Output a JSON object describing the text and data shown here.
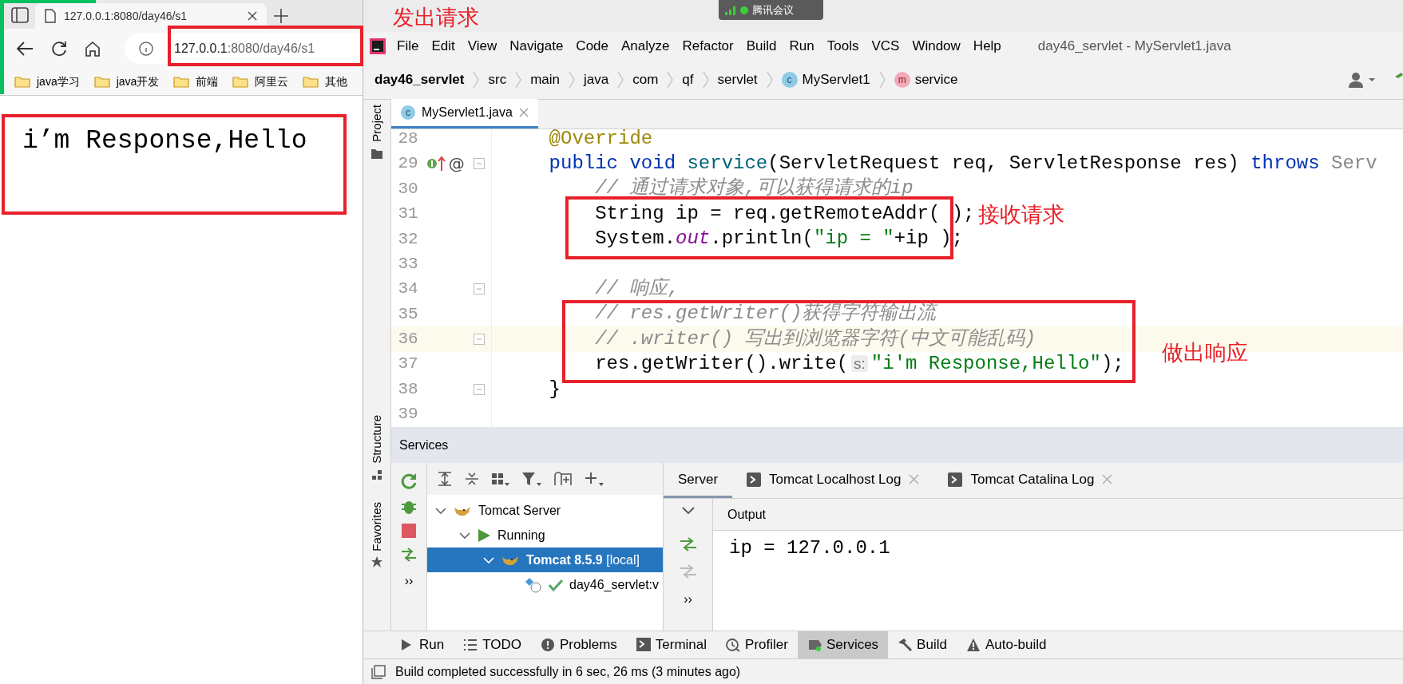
{
  "meeting_badge": {
    "label": "腾讯会议"
  },
  "browser": {
    "tabs": [
      {
        "title": "127.0.0.1:8080/day46/s1",
        "selected": true
      }
    ],
    "url": {
      "host": "127.0.0.1",
      "path": ":8080/day46/s1"
    },
    "bookmarks": [
      "java学习",
      "java开发",
      "前端",
      "阿里云",
      "其他"
    ],
    "page_text": "i’m Response,Hello"
  },
  "annotations": [
    {
      "label": "发出请求"
    },
    {
      "label": "接收请求"
    },
    {
      "label": "做出响应"
    }
  ],
  "ide": {
    "menu": [
      "File",
      "Edit",
      "View",
      "Navigate",
      "Code",
      "Analyze",
      "Refactor",
      "Build",
      "Run",
      "Tools",
      "VCS",
      "Window",
      "Help"
    ],
    "title": "day46_servlet - MyServlet1.java",
    "breadcrumbs": [
      {
        "text": "day46_servlet",
        "kind": "project"
      },
      {
        "text": "src",
        "kind": "folder"
      },
      {
        "text": "main",
        "kind": "folder"
      },
      {
        "text": "java",
        "kind": "folder"
      },
      {
        "text": "com",
        "kind": "folder"
      },
      {
        "text": "qf",
        "kind": "folder"
      },
      {
        "text": "servlet",
        "kind": "folder"
      },
      {
        "text": "MyServlet1",
        "kind": "class",
        "badge": "c"
      },
      {
        "text": "service",
        "kind": "method",
        "badge": "m"
      }
    ],
    "tool_windows_left": [
      "Project",
      "Structure",
      "Favorites"
    ],
    "editor_tabs": [
      {
        "label": "MyServlet1.java",
        "selected": true,
        "badge": "c"
      }
    ],
    "code": [
      {
        "number": "28",
        "tokens": [
          {
            "t": "    @Override",
            "kind": "annotation"
          }
        ]
      },
      {
        "number": "29",
        "gutter_mark": "@",
        "fold": true,
        "tokens": [
          {
            "t": "    public void ",
            "kind": "keyword"
          },
          {
            "t": "service",
            "kind": "method"
          },
          {
            "t": "(ServletRequest req, ServletResponse res) ",
            "kind": "plain"
          },
          {
            "t": "throws",
            "kind": "keyword"
          },
          {
            "t": " Serv",
            "kind": "faded"
          }
        ]
      },
      {
        "number": "30",
        "tokens": [
          {
            "t": "        // 通过请求对象,可以获得请求的ip",
            "kind": "comment"
          }
        ]
      },
      {
        "number": "31",
        "tokens": [
          {
            "t": "        String ip = req.getRemoteAddr( );",
            "kind": "plain"
          }
        ]
      },
      {
        "number": "32",
        "tokens": [
          {
            "t": "        System.",
            "kind": "plain"
          },
          {
            "t": "out",
            "kind": "field"
          },
          {
            "t": ".println(",
            "kind": "plain"
          },
          {
            "t": "\"ip = \"",
            "kind": "string"
          },
          {
            "t": "+ip );",
            "kind": "plain"
          }
        ]
      },
      {
        "number": "33"
      },
      {
        "number": "34",
        "fold": true,
        "tokens": [
          {
            "t": "        // 响应,",
            "kind": "comment"
          }
        ]
      },
      {
        "number": "35",
        "tokens": [
          {
            "t": "        // res.getWriter()获得字符输出流",
            "kind": "comment"
          }
        ]
      },
      {
        "number": "36",
        "fold": true,
        "current": true,
        "tokens": [
          {
            "t": "        // .writer() 写出到浏览器字符(中文可能乱码)",
            "kind": "comment"
          }
        ]
      },
      {
        "number": "37",
        "tokens": [
          {
            "t": "        res.getWriter().write(",
            "kind": "plain"
          },
          {
            "t": "s:",
            "kind": "hint"
          },
          {
            "t": "\"i'm Response,Hello\"",
            "kind": "string"
          },
          {
            "t": ");",
            "kind": "plain"
          }
        ]
      },
      {
        "number": "38",
        "fold": true,
        "tokens": [
          {
            "t": "    }",
            "kind": "plain"
          }
        ]
      },
      {
        "number": "39"
      }
    ],
    "services": {
      "title": "Services",
      "tree": [
        {
          "label": "Tomcat Server",
          "kind": "server",
          "expanded": true,
          "selected": false,
          "children": [
            {
              "label": "Running",
              "kind": "status",
              "expanded": true,
              "selected": false,
              "children": [
                {
                  "label": "**Tomcat 8.5.9** [local]",
                  "kind": "instance",
                  "expanded": true,
                  "selected": true,
                  "children": [
                    {
                      "label": "day46_servlet:v",
                      "kind": "artifact",
                      "selected": false
                    }
                  ]
                }
              ]
            }
          ]
        }
      ],
      "tabs": [
        {
          "label": "Server",
          "kind": "plain",
          "selected": true
        },
        {
          "label": "Tomcat Localhost Log",
          "kind": "log",
          "selected": false
        },
        {
          "label": "Tomcat Catalina Log",
          "kind": "log",
          "selected": false
        }
      ],
      "actions_more": "››",
      "output_more": "››",
      "output_header": "Output",
      "output_lines": [
        "ip = 127.0.0.1"
      ]
    },
    "bottom_tabs": [
      {
        "label": "Run",
        "kind": "run",
        "selected": false
      },
      {
        "label": "TODO",
        "kind": "todo",
        "selected": false
      },
      {
        "label": "Problems",
        "kind": "problems",
        "selected": false
      },
      {
        "label": "Terminal",
        "kind": "terminal",
        "selected": false
      },
      {
        "label": "Profiler",
        "kind": "profiler",
        "selected": false
      },
      {
        "label": "Services",
        "kind": "services",
        "selected": true
      },
      {
        "label": "Build",
        "kind": "build",
        "selected": false
      },
      {
        "label": "Auto-build",
        "kind": "warning",
        "selected": false
      }
    ],
    "status": "Build completed successfully in 6 sec, 26 ms (3 minutes ago)"
  }
}
